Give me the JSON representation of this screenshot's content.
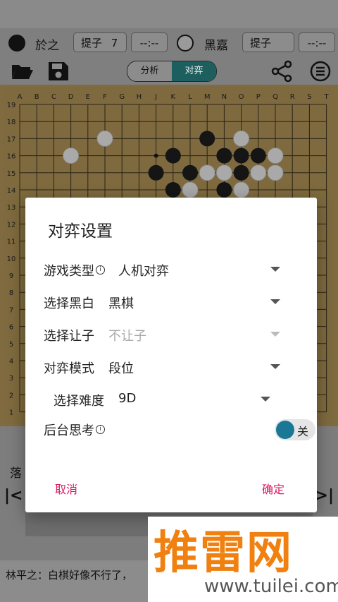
{
  "players": {
    "black": {
      "name": "於之",
      "captures_label": "提子",
      "captures": "7",
      "timer": "--:--"
    },
    "white": {
      "name": "黑嘉",
      "captures_label": "提子",
      "captures": "6",
      "timer": "--:--"
    }
  },
  "toolbar": {
    "open_icon": "folder-open-icon",
    "save_icon": "save-icon",
    "share_icon": "share-icon",
    "menu_icon": "menu-icon",
    "tabs": [
      {
        "label": "分析",
        "active": false
      },
      {
        "label": "对弈",
        "active": true
      }
    ]
  },
  "board": {
    "size": 19,
    "columns": [
      "A",
      "B",
      "C",
      "D",
      "E",
      "F",
      "G",
      "H",
      "J",
      "K",
      "L",
      "M",
      "N",
      "O",
      "P",
      "Q",
      "R",
      "S",
      "T"
    ],
    "rows": [
      "19",
      "18",
      "17",
      "16",
      "15",
      "14",
      "13",
      "12",
      "11",
      "10",
      "9",
      "8",
      "7",
      "6",
      "5",
      "4",
      "3",
      "2",
      "1"
    ],
    "black_stones": [
      "M17",
      "K16",
      "N16",
      "O16",
      "P16",
      "J15",
      "L15",
      "O15",
      "K14",
      "N14"
    ],
    "white_stones": [
      "F17",
      "O17",
      "D16",
      "Q16",
      "M15",
      "N15",
      "P15",
      "Q15",
      "L14",
      "O14",
      "B5"
    ],
    "last_move_marker": "J16"
  },
  "dialog": {
    "title": "对弈设置",
    "rows": [
      {
        "label": "游戏类型",
        "info": true,
        "value": "人机对弈",
        "disabled": false
      },
      {
        "label": "选择黑白",
        "info": false,
        "value": "黑棋",
        "disabled": false
      },
      {
        "label": "选择让子",
        "info": false,
        "value": "不让子",
        "disabled": true
      },
      {
        "label": "对弈模式",
        "info": false,
        "value": "段位",
        "disabled": false
      },
      {
        "label": "选择难度",
        "info": false,
        "value": "9D",
        "disabled": false
      }
    ],
    "background_thinking": {
      "label": "后台思考",
      "info": true,
      "state": "关"
    },
    "cancel": "取消",
    "confirm": "确定"
  },
  "below": {
    "side_label": "落",
    "chat": "林平之：白棋好像不行了，"
  },
  "watermark": {
    "title": "推雷网",
    "url": "www.tuilei.com"
  },
  "colors": {
    "accent": "#1d5f5f",
    "dialog_button": "#d81b60",
    "toggle_knob": "#1a7795",
    "watermark": "#f08010"
  }
}
